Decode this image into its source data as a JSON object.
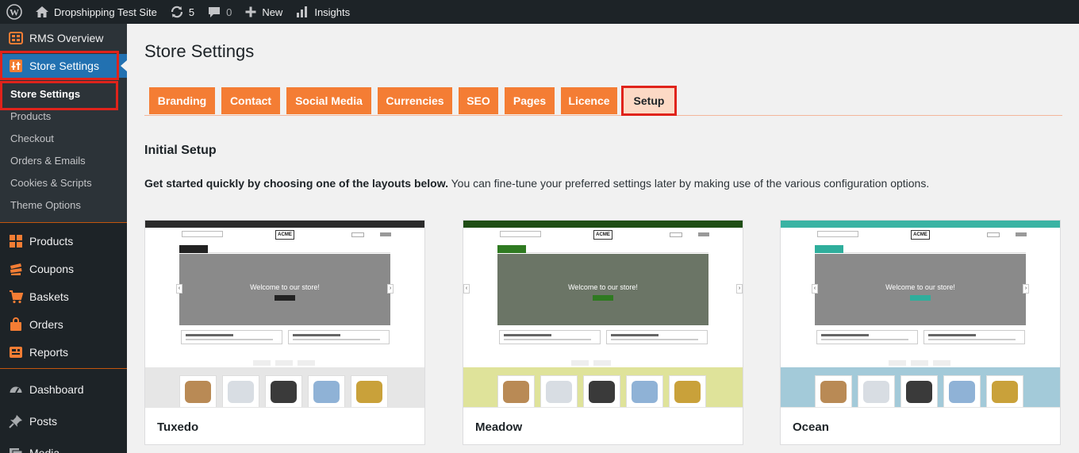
{
  "admin_bar": {
    "site_name": "Dropshipping Test Site",
    "updates_count": "5",
    "comments_count": "0",
    "new_label": "New",
    "insights_label": "Insights"
  },
  "sidebar": {
    "rms_overview": "RMS Overview",
    "store_settings": "Store Settings",
    "submenu": [
      "Store Settings",
      "Products",
      "Checkout",
      "Orders & Emails",
      "Cookies & Scripts",
      "Theme Options"
    ],
    "wc_items": [
      "Products",
      "Coupons",
      "Baskets",
      "Orders",
      "Reports"
    ],
    "core_items": [
      "Dashboard",
      "Posts",
      "Media"
    ]
  },
  "page": {
    "title": "Store Settings",
    "tabs": [
      "Branding",
      "Contact",
      "Social Media",
      "Currencies",
      "SEO",
      "Pages",
      "Licence",
      "Setup"
    ],
    "active_tab": "Setup",
    "section_title": "Initial Setup",
    "intro_bold": "Get started quickly by choosing one of the layouts below.",
    "intro_rest": " You can fine-tune your preferred settings later by making use of the various configuration options."
  },
  "layouts": [
    {
      "name": "Tuxedo",
      "logo": "ACME",
      "welcome": "Welcome to our store!",
      "top_color": "#2b2b2b",
      "accent": "#222222",
      "band": "#e6e6e6"
    },
    {
      "name": "Meadow",
      "logo": "ACME",
      "welcome": "Welcome to our store!",
      "top_color": "#1e4d14",
      "accent": "#2f7a21",
      "band": "#dfe39a"
    },
    {
      "name": "Ocean",
      "logo": "ACME",
      "welcome": "Welcome to our store!",
      "top_color": "#39b3a3",
      "accent": "#2fae9c",
      "band": "#a3cad9"
    }
  ],
  "colors": {
    "admin_dark": "#1d2327",
    "menu_highlight": "#2271b1",
    "tab_orange": "#f47d34",
    "tab_active_bg": "#fcd9c5",
    "annotation_red": "#e0231b"
  },
  "icons": {
    "wordpress": "wordpress-logo-icon",
    "home": "home-icon",
    "updates": "refresh-icon",
    "comments": "comment-bubble-icon",
    "new": "plus-icon",
    "insights": "bar-chart-icon"
  }
}
